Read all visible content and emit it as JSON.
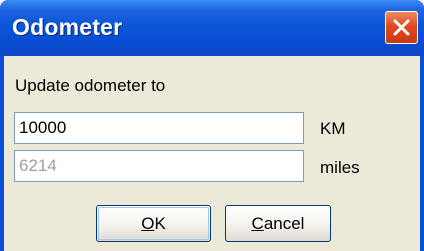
{
  "window": {
    "title": "Odometer"
  },
  "form": {
    "prompt": "Update odometer to",
    "km_value": "10000",
    "km_unit": "KM",
    "miles_value": "6214",
    "miles_unit": "miles"
  },
  "buttons": {
    "ok_mnemonic": "O",
    "ok_rest": "K",
    "cancel_mnemonic": "C",
    "cancel_rest": "ancel"
  },
  "icons": {
    "close": "close-icon"
  },
  "colors": {
    "titlebar": "#0a4fd6",
    "client": "#ece9d8",
    "close": "#e04a22"
  }
}
